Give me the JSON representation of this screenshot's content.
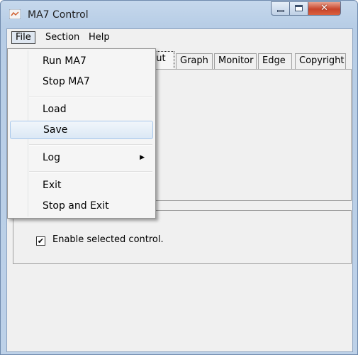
{
  "window": {
    "title": "MA7 Control"
  },
  "menubar": {
    "file": "File",
    "section": "Section",
    "help": "Help"
  },
  "tabs": [
    "put",
    "Graph",
    "Monitor",
    "Edge",
    "Copyright"
  ],
  "control": {
    "checkbox_label": "Enable selected control.",
    "checked": true,
    "check_glyph": "✔"
  },
  "file_menu": {
    "items": [
      {
        "label": "Run MA7"
      },
      {
        "label": "Stop MA7"
      },
      {
        "label": "Load"
      },
      {
        "label": "Save",
        "hovered": true
      },
      {
        "label": "Log",
        "submenu": true
      },
      {
        "label": "Exit"
      },
      {
        "label": "Stop and Exit"
      }
    ],
    "submenu_arrow": "▶"
  },
  "colors": {
    "close_button": "#c8452c",
    "hover_border": "#a8c7ea",
    "titlebar": "#bdd1e8"
  }
}
